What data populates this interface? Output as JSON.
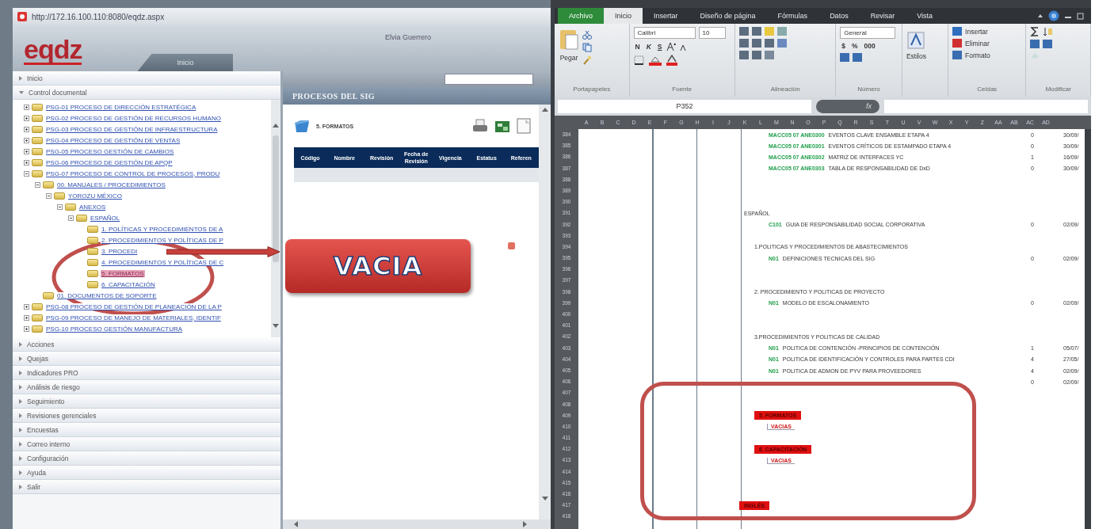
{
  "browser": {
    "address": "http://172.16.100.110:8080/eqdz.aspx",
    "logo": "eqdz",
    "user": "Elvia Guerrero",
    "header_tab": "Inicio",
    "sections": [
      {
        "label": "Inicio",
        "expanded": false
      },
      {
        "label": "Control documental",
        "expanded": true,
        "tree": [
          {
            "label": "PSG-01 PROCESO DE DIRECCIÓN ESTRATÉGICA",
            "expanded": false,
            "selected": false
          },
          {
            "label": "PSG-02 PROCESO DE GESTIÓN DE RECURSOS HUMANO",
            "expanded": false,
            "selected": false
          },
          {
            "label": "PSG-03 PROCESO DE GESTIÓN DE INFRAESTRUCTURA",
            "expanded": false,
            "selected": false
          },
          {
            "label": "PSG-04 PROCESO DE GESTIÓN DE VENTAS",
            "expanded": false,
            "selected": false
          },
          {
            "label": "PSG-05 PROCESO GESTIÓN DE CAMBIOS",
            "expanded": false,
            "selected": false
          },
          {
            "label": "PSG-06 PROCESO DE GESTIÓN DE APQP",
            "expanded": false,
            "selected": false
          },
          {
            "label": "PSG-07 PROCESO DE CONTROL DE PROCESOS, PRODU",
            "expanded": true,
            "selected": false,
            "children": [
              {
                "label": "00. MANUALES / PROCEDIMIENTOS",
                "expanded": true,
                "selected": false,
                "children": [
                  {
                    "label": "YOROZU MÉXICO",
                    "expanded": true,
                    "selected": false,
                    "children": [
                      {
                        "label": "ANEXOS",
                        "expanded": true,
                        "selected": false,
                        "children": [
                          {
                            "label": "ESPAÑOL",
                            "expanded": true,
                            "selected": false,
                            "children": [
                              {
                                "label": "1. POLÍTICAS Y PROCEDIMIENTOS DE A",
                                "selected": false
                              },
                              {
                                "label": "2. PROCEDIMIENTOS Y POLÍTICAS DE P",
                                "selected": false
                              },
                              {
                                "label": "3. PROCEDI",
                                "selected": false
                              },
                              {
                                "label": "4. PROCEDIMIENTOS Y POLÍTICAS DE C",
                                "selected": false
                              },
                              {
                                "label": "5. FORMATOS",
                                "selected": true
                              },
                              {
                                "label": "6. CAPACITACIÓN",
                                "selected": false
                              }
                            ]
                          }
                        ]
                      }
                    ]
                  }
                ]
              },
              {
                "label": "01. DOCUMENTOS DE SOPORTE",
                "selected": false
              }
            ]
          },
          {
            "label": "PSG-08 PROCESO DE GESTIÓN DE PLANEACIÓN DE LA P",
            "expanded": false,
            "selected": false
          },
          {
            "label": "PSG-09 PROCESO DE MANEJO DE MATERIALES, IDENTIF",
            "expanded": false,
            "selected": false
          },
          {
            "label": "PSG-10 PROCESO GESTIÓN MANUFACTURA",
            "expanded": false,
            "selected": false
          }
        ]
      },
      {
        "label": "Acciones",
        "expanded": false
      },
      {
        "label": "Quejas",
        "expanded": false
      },
      {
        "label": "Indicadores PRO",
        "expanded": false
      },
      {
        "label": "Análisis de riesgo",
        "expanded": false
      },
      {
        "label": "Seguimiento",
        "expanded": false
      },
      {
        "label": "Revisiones gerenciales",
        "expanded": false
      },
      {
        "label": "Encuestas",
        "expanded": false
      },
      {
        "label": "Correo interno",
        "expanded": false
      },
      {
        "label": "Configuración",
        "expanded": false
      },
      {
        "label": "Ayuda",
        "expanded": false
      },
      {
        "label": "Salir",
        "expanded": false
      }
    ],
    "panel": {
      "title": "PROCESOS DEL SIG",
      "folder": "5. FORMATOS",
      "columns": [
        "Código",
        "Nombre",
        "Revisión",
        "Fecha de Revisión",
        "Vigencia",
        "Estatus",
        "Referen"
      ]
    }
  },
  "excel": {
    "tabs": [
      {
        "label": "Archivo",
        "kind": "file",
        "selected": false
      },
      {
        "label": "Inicio",
        "kind": "tab",
        "selected": true
      },
      {
        "label": "Insertar",
        "kind": "tab",
        "selected": false
      },
      {
        "label": "Diseño de página",
        "kind": "tab",
        "selected": false
      },
      {
        "label": "Fórmulas",
        "kind": "tab",
        "selected": false
      },
      {
        "label": "Datos",
        "kind": "tab",
        "selected": false
      },
      {
        "label": "Revisar",
        "kind": "tab",
        "selected": false
      },
      {
        "label": "Vista",
        "kind": "tab",
        "selected": false
      }
    ],
    "ribbon": {
      "paste": "Pegar",
      "clipboard": "Portapapeles",
      "font": "Calibri",
      "size": "10",
      "bold": "N",
      "italic": "K",
      "underline": "S",
      "font_group": "Fuente",
      "alignment": "Alineación",
      "number_format": "General",
      "currency": "$",
      "percent": "%",
      "thousands": "000",
      "number": "Número",
      "styles": "Estilos",
      "insert": "Insertar",
      "delete": "Eliminar",
      "format": "Formato",
      "cells": "Celdas",
      "modify": "Modificar"
    },
    "name_box": "P352",
    "function_label": "fx",
    "columns": [
      "A",
      "B",
      "C",
      "D",
      "E",
      "F",
      "G",
      "H",
      "I",
      "J",
      "K",
      "L",
      "M",
      "N",
      "O",
      "P",
      "Q",
      "R",
      "S",
      "T",
      "U",
      "V",
      "W",
      "X",
      "Y",
      "Z",
      "AA",
      "AB",
      "AC",
      "AD"
    ],
    "rows": [
      {
        "n": "384",
        "kind": "item",
        "code": "MACC05 07 ANE0300",
        "name": "EVENTOS CLAVE ENSAMBLE ETAPA 4",
        "rev": "0",
        "date": "30/09/"
      },
      {
        "n": "385",
        "kind": "item",
        "code": "MACC05 07 ANE0301",
        "name": "EVENTOS CRÍTICOS DE ESTAMPADO ETAPA 4",
        "rev": "0",
        "date": "30/09/"
      },
      {
        "n": "386",
        "kind": "item",
        "code": "MACC05 07 ANE0302",
        "name": "MATRIZ DE INTERFACES YC",
        "rev": "1",
        "date": "16/09/"
      },
      {
        "n": "387",
        "kind": "item",
        "code": "MACC05 07 ANE0303",
        "name": "TABLA DE RESPONSABILIDAD DE DxD",
        "rev": "0",
        "date": "30/09/"
      },
      {
        "n": "388",
        "kind": "blank"
      },
      {
        "n": "389",
        "kind": "blank"
      },
      {
        "n": "390",
        "kind": "blank"
      },
      {
        "n": "391",
        "kind": "folder",
        "name": "ESPAÑOL"
      },
      {
        "n": "392",
        "kind": "item",
        "code": "C101",
        "name": "GUIA DE RESPONSABILIDAD SOCIAL CORPORATIVA",
        "rev": "0",
        "date": "02/09/"
      },
      {
        "n": "393",
        "kind": "blank"
      },
      {
        "n": "394",
        "kind": "subfolder",
        "name": "1.POLITICAS Y PROCEDIMIENTOS DE ABASTECIMIENTOS"
      },
      {
        "n": "395",
        "kind": "item",
        "code": "N01",
        "name": "DEFINICIONES TECNICAS DEL SIG",
        "rev": "0",
        "date": "02/09/"
      },
      {
        "n": "396",
        "kind": "blank"
      },
      {
        "n": "397",
        "kind": "blank"
      },
      {
        "n": "398",
        "kind": "subfolder",
        "name": "2. PROCEDIMIENTO Y POLITICAS DE PROYECTO"
      },
      {
        "n": "399",
        "kind": "item",
        "code": "N01",
        "name": "MODELO DE ESCALONAMIENTO",
        "rev": "0",
        "date": "02/09/"
      },
      {
        "n": "400",
        "kind": "blank"
      },
      {
        "n": "401",
        "kind": "blank"
      },
      {
        "n": "402",
        "kind": "subfolder",
        "name": "3.PROCEDIMIENTOS Y POLITICAS DE CALIDAD"
      },
      {
        "n": "403",
        "kind": "item",
        "code": "N01",
        "name": "POLITICA DE CONTENCIÓN -PRINCIPIOS DE CONTENCIÓN",
        "rev": "1",
        "date": "05/07/"
      },
      {
        "n": "404",
        "kind": "item",
        "code": "N01",
        "name": "POLITICA DE IDENTIFICACIÓN Y CONTROLES PARA PARTES CDI",
        "rev": "4",
        "date": "27/05/"
      },
      {
        "n": "405",
        "kind": "item",
        "code": "N01",
        "name": "POLITICA DE ADMON DE PYV PARA PROVEEDORES",
        "rev": "4",
        "date": "02/09/"
      },
      {
        "n": "406",
        "kind": "item",
        "rev": "0",
        "date": "02/09/"
      },
      {
        "n": "407",
        "kind": "blank"
      },
      {
        "n": "408",
        "kind": "blank"
      },
      {
        "n": "409",
        "kind": "empty-folder",
        "name": "5. FORMATOS"
      },
      {
        "n": "410",
        "kind": "note",
        "name": "VACIAS"
      },
      {
        "n": "411",
        "kind": "blank"
      },
      {
        "n": "412",
        "kind": "empty-folder",
        "name": "6. CAPACITACIÓN"
      },
      {
        "n": "413",
        "kind": "note",
        "name": "VACIAS"
      },
      {
        "n": "414",
        "kind": "blank"
      },
      {
        "n": "415",
        "kind": "blank"
      },
      {
        "n": "416",
        "kind": "blank"
      },
      {
        "n": "417",
        "kind": "language",
        "name": "INGLÉS"
      },
      {
        "n": "418",
        "kind": "blank"
      }
    ]
  },
  "annotation": {
    "callout": "VACIA"
  }
}
